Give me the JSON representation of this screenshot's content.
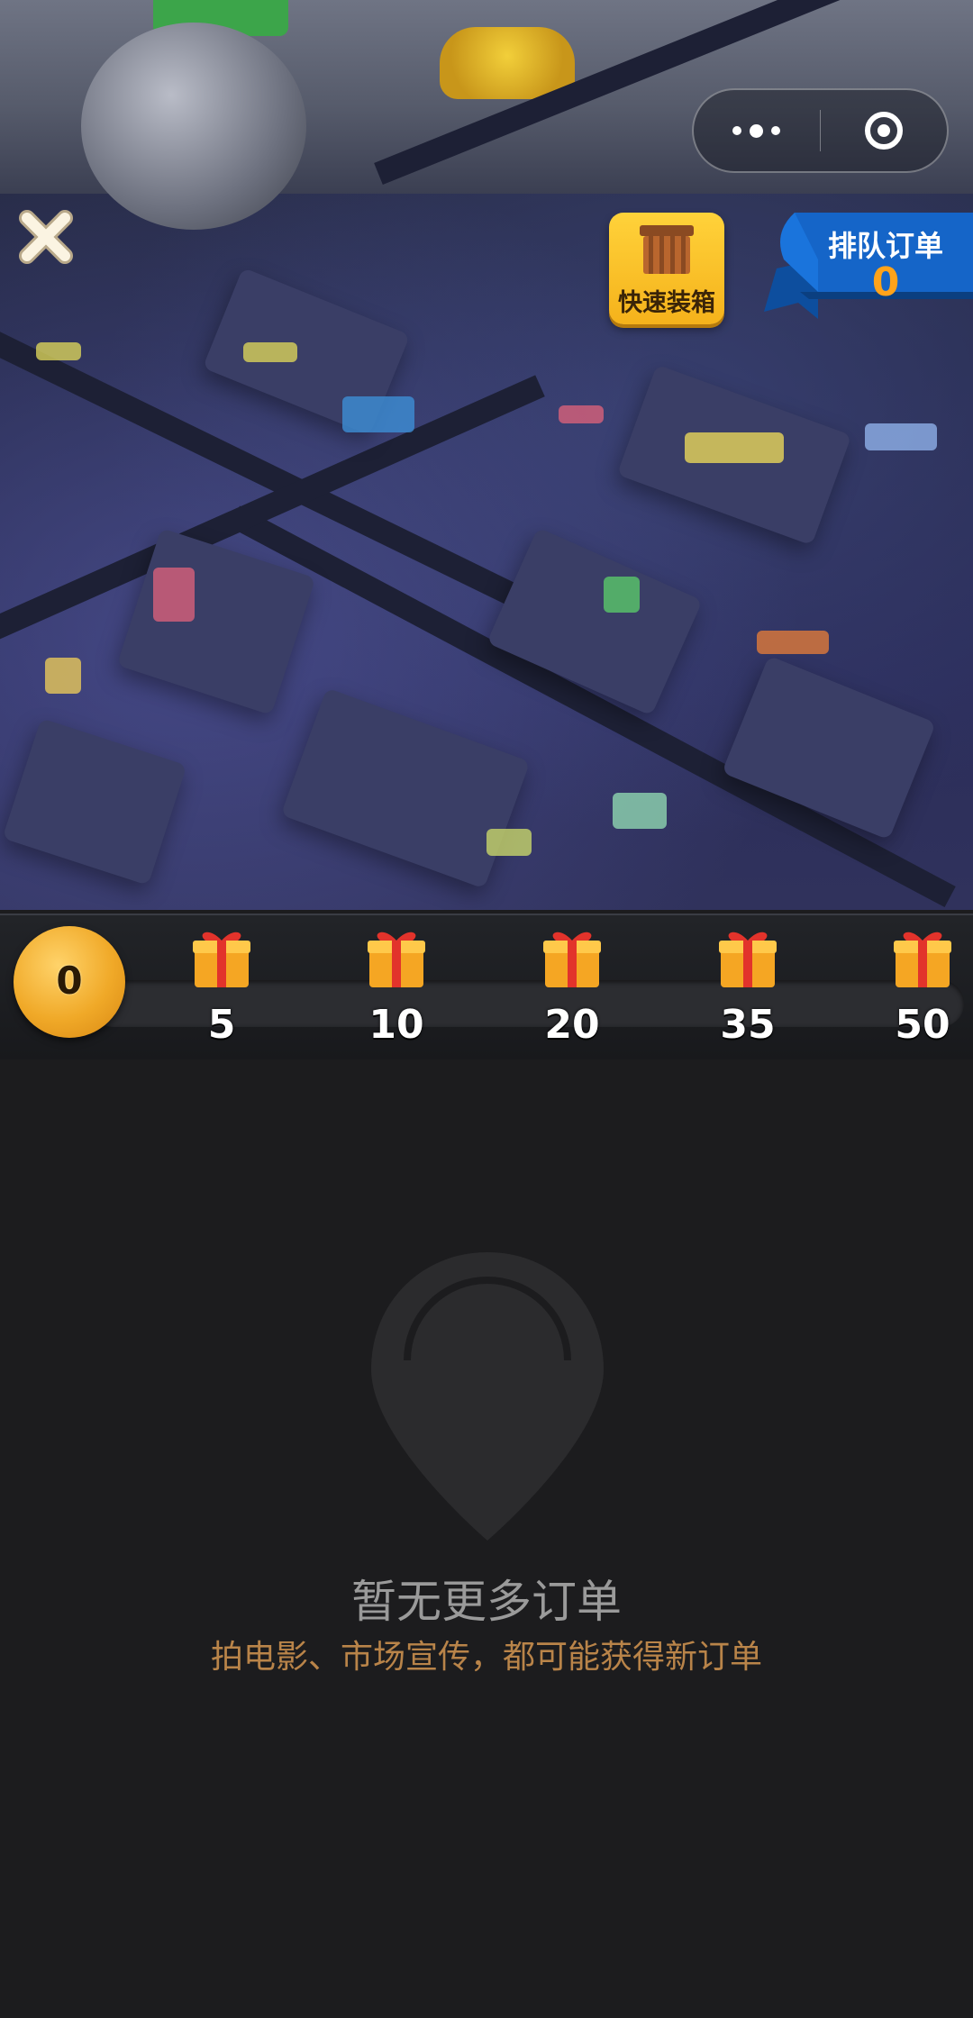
{
  "header": {
    "close_icon": "close-icon",
    "menu_icon": "more-dots-icon",
    "target_icon": "target-icon"
  },
  "quick_pack": {
    "label": "快速装箱",
    "icon": "crate-icon"
  },
  "queue_orders": {
    "title": "排队订单",
    "count": "0"
  },
  "progress": {
    "current": "0",
    "milestones": [
      {
        "value": "5",
        "icon": "gift-icon"
      },
      {
        "value": "10",
        "icon": "gift-icon"
      },
      {
        "value": "20",
        "icon": "gift-icon"
      },
      {
        "value": "35",
        "icon": "gift-icon"
      },
      {
        "value": "50",
        "icon": "gift-icon"
      }
    ]
  },
  "empty_state": {
    "icon": "location-pin-icon",
    "title": "暂无更多订单",
    "subtitle": "拍电影、市场宣传，都可能获得新订单"
  },
  "colors": {
    "accent_gold": "#f5b21b",
    "queue_blue": "#1565c8",
    "subtitle_orange": "#b98449",
    "background": "#1c1c1e"
  }
}
